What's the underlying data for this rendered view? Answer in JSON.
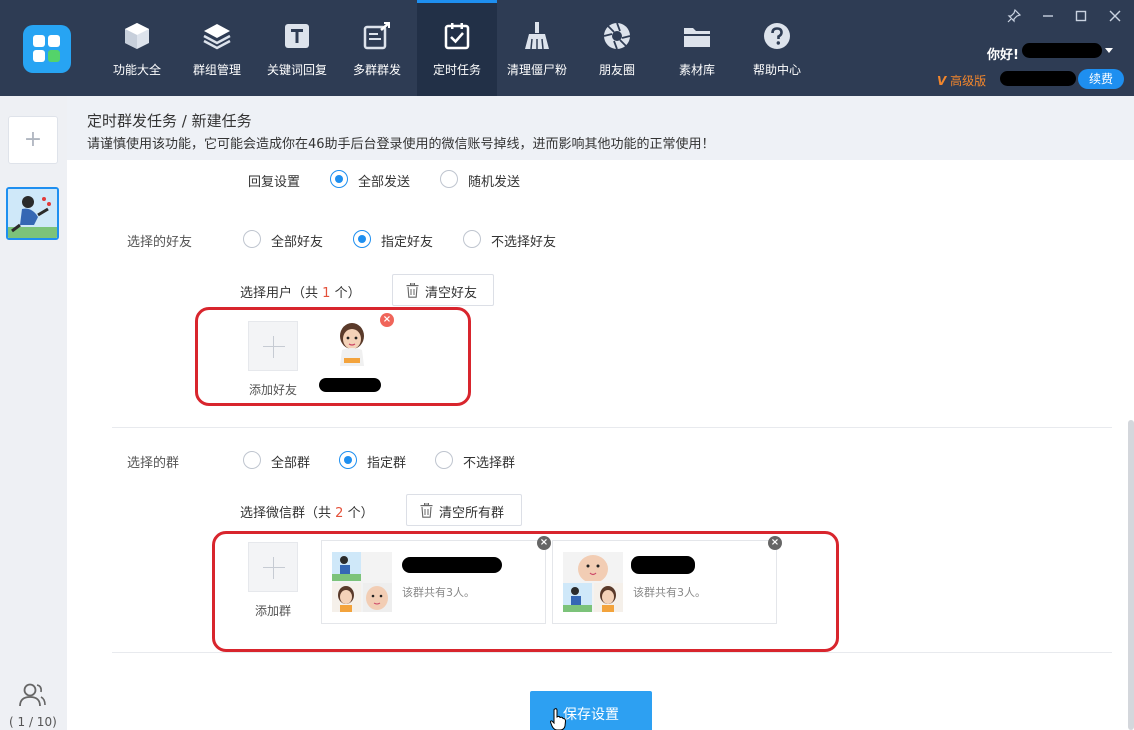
{
  "topbar": {
    "nav": [
      {
        "label": "功能大全",
        "icon": "cube-icon"
      },
      {
        "label": "群组管理",
        "icon": "layers-icon"
      },
      {
        "label": "关键词回复",
        "icon": "text-t-icon"
      },
      {
        "label": "多群群发",
        "icon": "edit-share-icon"
      },
      {
        "label": "定时任务",
        "icon": "calendar-check-icon"
      },
      {
        "label": "清理僵尸粉",
        "icon": "broom-icon"
      },
      {
        "label": "朋友圈",
        "icon": "aperture-icon"
      },
      {
        "label": "素材库",
        "icon": "folder-icon"
      },
      {
        "label": "帮助中心",
        "icon": "question-icon"
      }
    ],
    "active_nav": "定时任务",
    "greeting": "你好!",
    "vip_label": "高级版",
    "renew_label": "续费",
    "window_controls": [
      "pin-icon",
      "minimize-icon",
      "maximize-icon",
      "close-icon"
    ]
  },
  "sidebar": {
    "add_symbol": "+",
    "account_count": "( 1 / 10)"
  },
  "header": {
    "breadcrumb": "定时群发任务 / 新建任务",
    "warning": "请谨慎使用该功能，它可能会造成你在46助手后台登录使用的微信账号掉线，进而影响其他功能的正常使用！"
  },
  "form": {
    "reply": {
      "label": "回复设置",
      "options": [
        "全部发送",
        "随机发送"
      ],
      "selected": "全部发送"
    },
    "friends": {
      "label": "选择的好友",
      "options": [
        "全部好友",
        "指定好友",
        "不选择好友"
      ],
      "selected": "指定好友",
      "select_prefix": "选择用户（共",
      "select_count": "1",
      "select_suffix": "个）",
      "clear_label": "清空好友",
      "add_label": "添加好友"
    },
    "groups": {
      "label": "选择的群",
      "options": [
        "全部群",
        "指定群",
        "不选择群"
      ],
      "selected": "指定群",
      "select_prefix": "选择微信群（共",
      "select_count": "2",
      "select_suffix": "个）",
      "clear_label": "清空所有群",
      "add_label": "添加群",
      "cards": [
        {
          "member_text": "该群共有3人。"
        },
        {
          "member_text": "该群共有3人。"
        }
      ]
    },
    "save_label": "保存设置"
  },
  "colors": {
    "topbar": "#2e3c54",
    "accent": "#1e8ff0",
    "highlight": "#d8252d",
    "vip": "#f2862c"
  }
}
